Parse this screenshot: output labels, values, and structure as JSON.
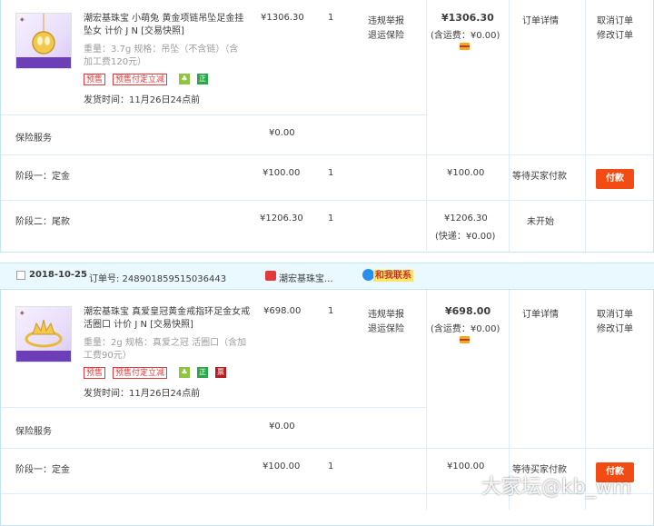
{
  "order1": {
    "product": {
      "title": "潮宏基珠宝 小萌兔 黄金项链吊坠足金挂坠女 计价 J N [交易快照]",
      "title_line1": "潮宏基珠宝 小萌兔 黄金项链吊坠足金挂",
      "title_line2": "坠女 计价 J N [交易快照]",
      "spec_line1": "重量：3.7g  规格：吊坠（不含链）（含",
      "spec_line2": "加工费120元）",
      "tags": [
        "预售",
        "预售付定立减"
      ],
      "icons": [
        "store-badge-icon",
        "genuine-badge-icon"
      ],
      "icon_texts": [
        "",
        "正"
      ],
      "ship_time": "发货时间：11月26日24点前"
    },
    "price": "¥1306.30",
    "qty": "1",
    "service_links": [
      "违规举报",
      "退运保险"
    ],
    "total": "¥1306.30",
    "shipping_note": "(含运费：¥0.00)",
    "status_link": "订单详情",
    "actions": [
      "取消订单",
      "修改订单"
    ],
    "insurance": {
      "label": "保险服务",
      "price": "¥0.00"
    },
    "stage1": {
      "label": "阶段一：定金",
      "price": "¥100.00",
      "qty": "1",
      "amount": "¥100.00",
      "status": "等待买家付款",
      "pay": "付款"
    },
    "stage2": {
      "label": "阶段二：尾款",
      "price": "¥1206.30",
      "qty": "1",
      "amount": "¥1206.30",
      "note": "(快递：¥0.00)",
      "status": "未开始"
    }
  },
  "order2": {
    "header": {
      "date": "2018-10-25",
      "order_no": "订单号: 248901859515036443",
      "shop_name": "潮宏基珠宝...",
      "contact": "和我联系"
    },
    "product": {
      "title_line1": "潮宏基珠宝 真爱皇冠黄金戒指环足金女戒",
      "title_line2": "活圈口 计价 J N [交易快照]",
      "spec_line1": "重量：2g  规格：真爱之冠 活圈口（含加",
      "spec_line2": "工费90元）",
      "tags": [
        "预售",
        "预售付定立减"
      ],
      "icons": [
        "store-badge-icon",
        "genuine-badge-icon",
        "seal-badge-icon"
      ],
      "icon_texts": [
        "",
        "正",
        "票"
      ],
      "ship_time": "发货时间：11月26日24点前"
    },
    "price": "¥698.00",
    "qty": "1",
    "service_links": [
      "违规举报",
      "退运保险"
    ],
    "total": "¥698.00",
    "shipping_note": "(含运费：¥0.00)",
    "status_link": "订单详情",
    "actions": [
      "取消订单",
      "修改订单"
    ],
    "insurance": {
      "label": "保险服务",
      "price": "¥0.00"
    },
    "stage1": {
      "label": "阶段一：定金",
      "price": "¥100.00",
      "qty": "1",
      "amount": "¥100.00",
      "status": "等待买家付款",
      "pay": "付款"
    }
  },
  "watermark": "大家坛@kb_wm",
  "colors": {
    "accent_orange": "#f24b13",
    "tag_red": "#e4393c",
    "header_bg": "#eaf8ff",
    "border": "#c4e3f3"
  }
}
